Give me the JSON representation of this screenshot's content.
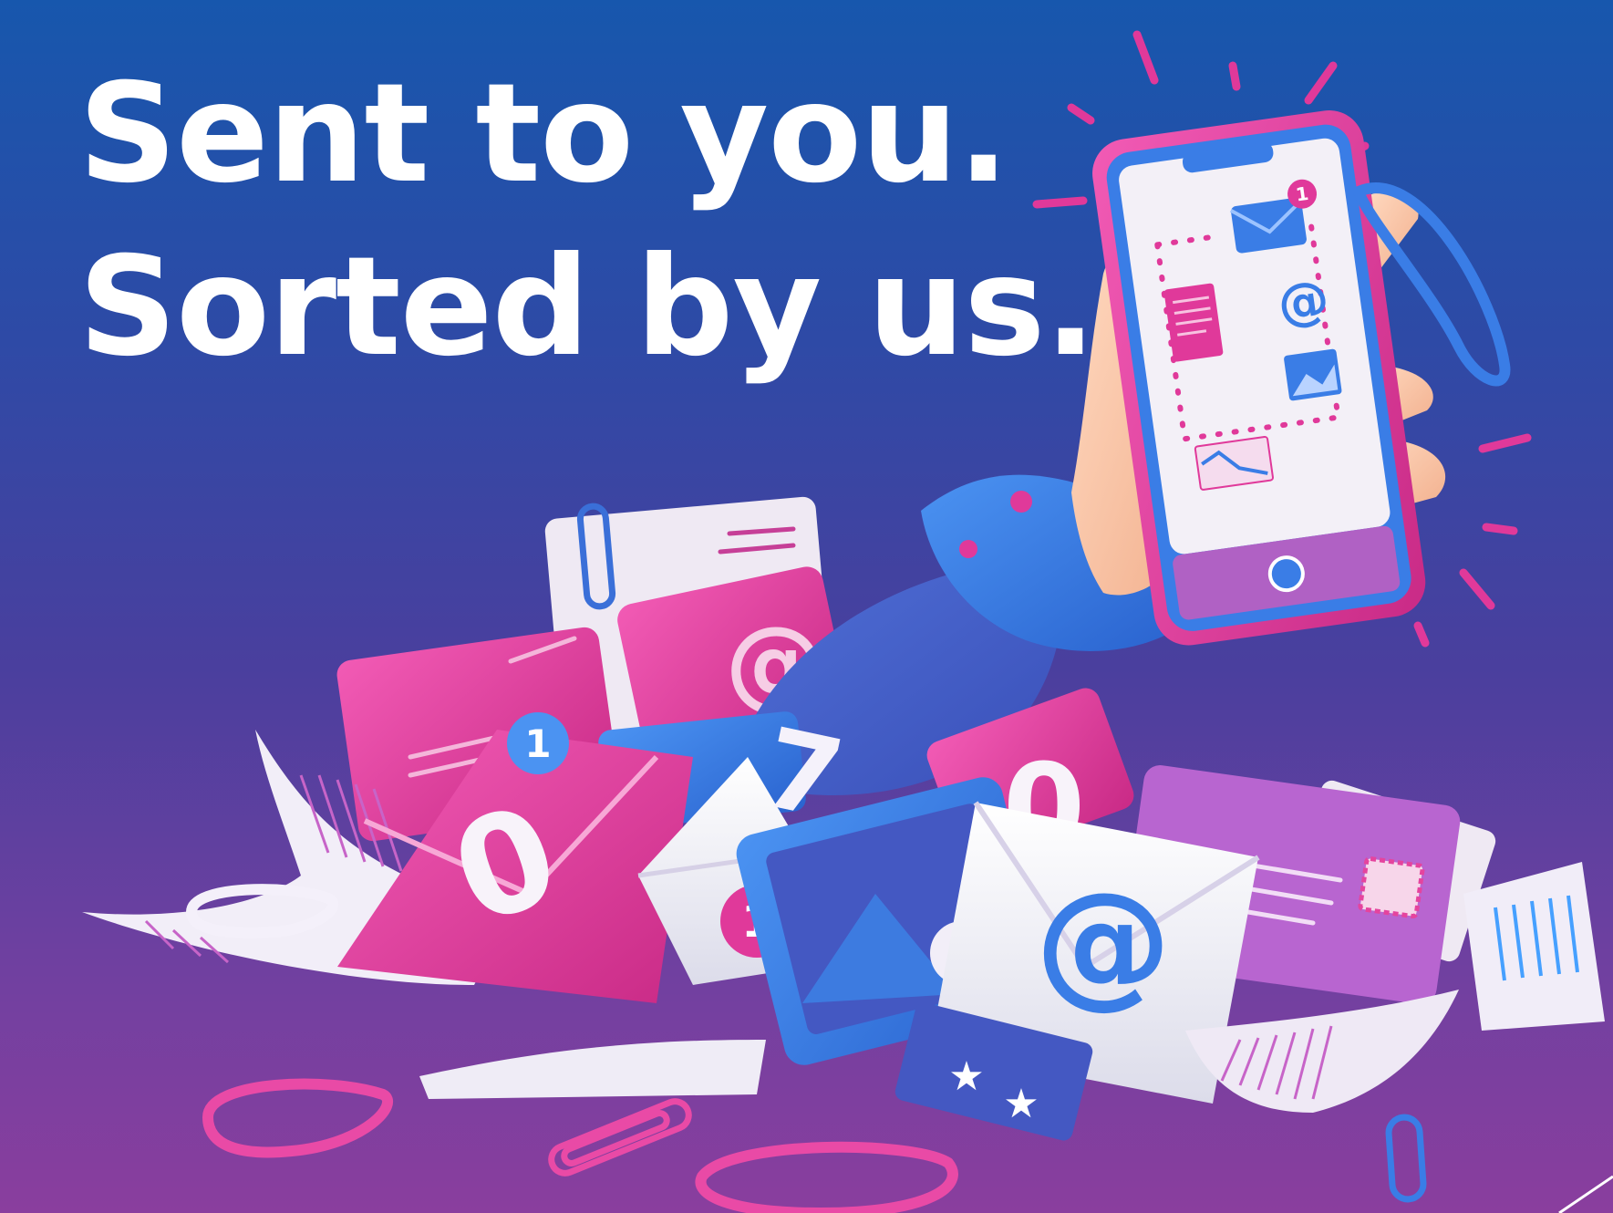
{
  "headline": {
    "line1": "Sent to you.",
    "line2": "Sorted by us."
  },
  "illustration": {
    "phone_badge": "1",
    "envelope_badges": [
      "1",
      "1"
    ],
    "at_symbol": "@",
    "floating_digits": [
      "0",
      "7",
      "0"
    ]
  },
  "colors": {
    "bg_top": "#1757ad",
    "bg_bottom": "#8a3e9e",
    "pink": "#e0399a",
    "blue": "#3a7de6",
    "white": "#ffffff",
    "lavender": "#b46fd0"
  },
  "icons": [
    "hand-with-phone-icon",
    "envelope-icon",
    "at-sign-icon",
    "image-icon",
    "paperclip-icon",
    "rubber-band-icon",
    "document-icon",
    "chart-icon",
    "stamp-icon",
    "star-icon"
  ]
}
